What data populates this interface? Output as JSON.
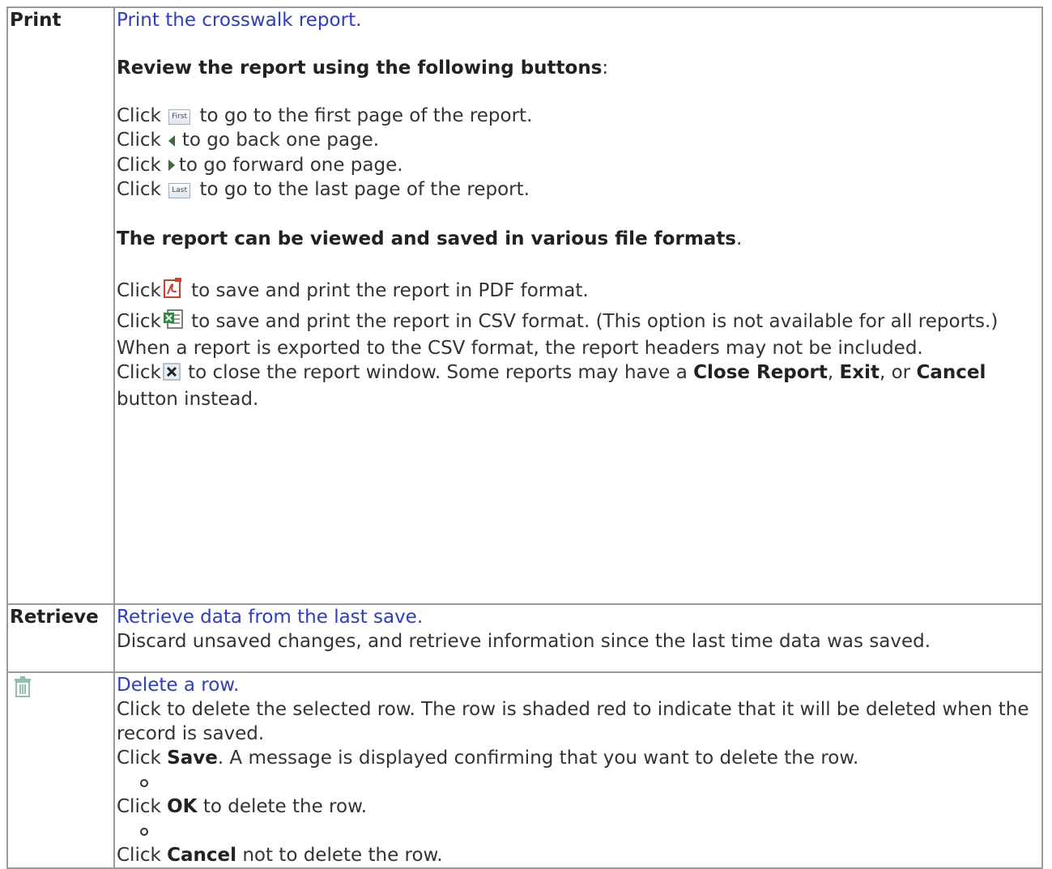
{
  "rows": {
    "print": {
      "label": "Print",
      "link": "Print the crosswalk report.",
      "review_heading": "Review the report using the following buttons",
      "review_colon": ":",
      "nav": [
        {
          "pre": "Click",
          "btn": "First",
          "post": "to go to the first page of the report."
        },
        {
          "pre": "Click",
          "post": "to go back one page."
        },
        {
          "pre": "Click",
          "post": "to go forward one page."
        },
        {
          "pre": "Click",
          "btn": "Last",
          "post": "to go to the last page of the report."
        }
      ],
      "formats_heading": "The report can be viewed and saved in various file formats",
      "formats_period": ".",
      "pdf": {
        "pre": "Click",
        "post": "to save and print the report in PDF format."
      },
      "csv": {
        "pre": "Click",
        "post": "to save and print the report in CSV format. (This option is not available for all reports.) When a report is exported to the CSV format, the report headers may not be included."
      },
      "close": {
        "pre": "Click",
        "mid": "to close the report window. Some reports may have a",
        "b1": "Close Report",
        "sep1": ",",
        "b2": "Exit",
        "sep2": ", or",
        "b3": "Cancel",
        "end": "button instead."
      }
    },
    "retrieve": {
      "label": "Retrieve",
      "link": "Retrieve data from the last save.",
      "desc": "Discard unsaved changes, and retrieve information since the last time data was saved."
    },
    "delete": {
      "link": "Delete a row.",
      "desc": "Click to delete the selected row. The row is shaded red to indicate that it will be deleted when the record is saved.",
      "save_pre": "Click",
      "save_b": "Save",
      "save_post": ". A message is displayed confirming that you want to delete the row.",
      "ok_pre": "Click",
      "ok_b": "OK",
      "ok_post": "to delete the row.",
      "cancel_pre": "Click",
      "cancel_b": "Cancel",
      "cancel_post": "not to delete the row."
    }
  },
  "colors": {
    "link": "#2b3bd6",
    "border": "#9a9a9a",
    "pdf_red": "#d93a2b",
    "excel_green": "#2e8b3a"
  }
}
